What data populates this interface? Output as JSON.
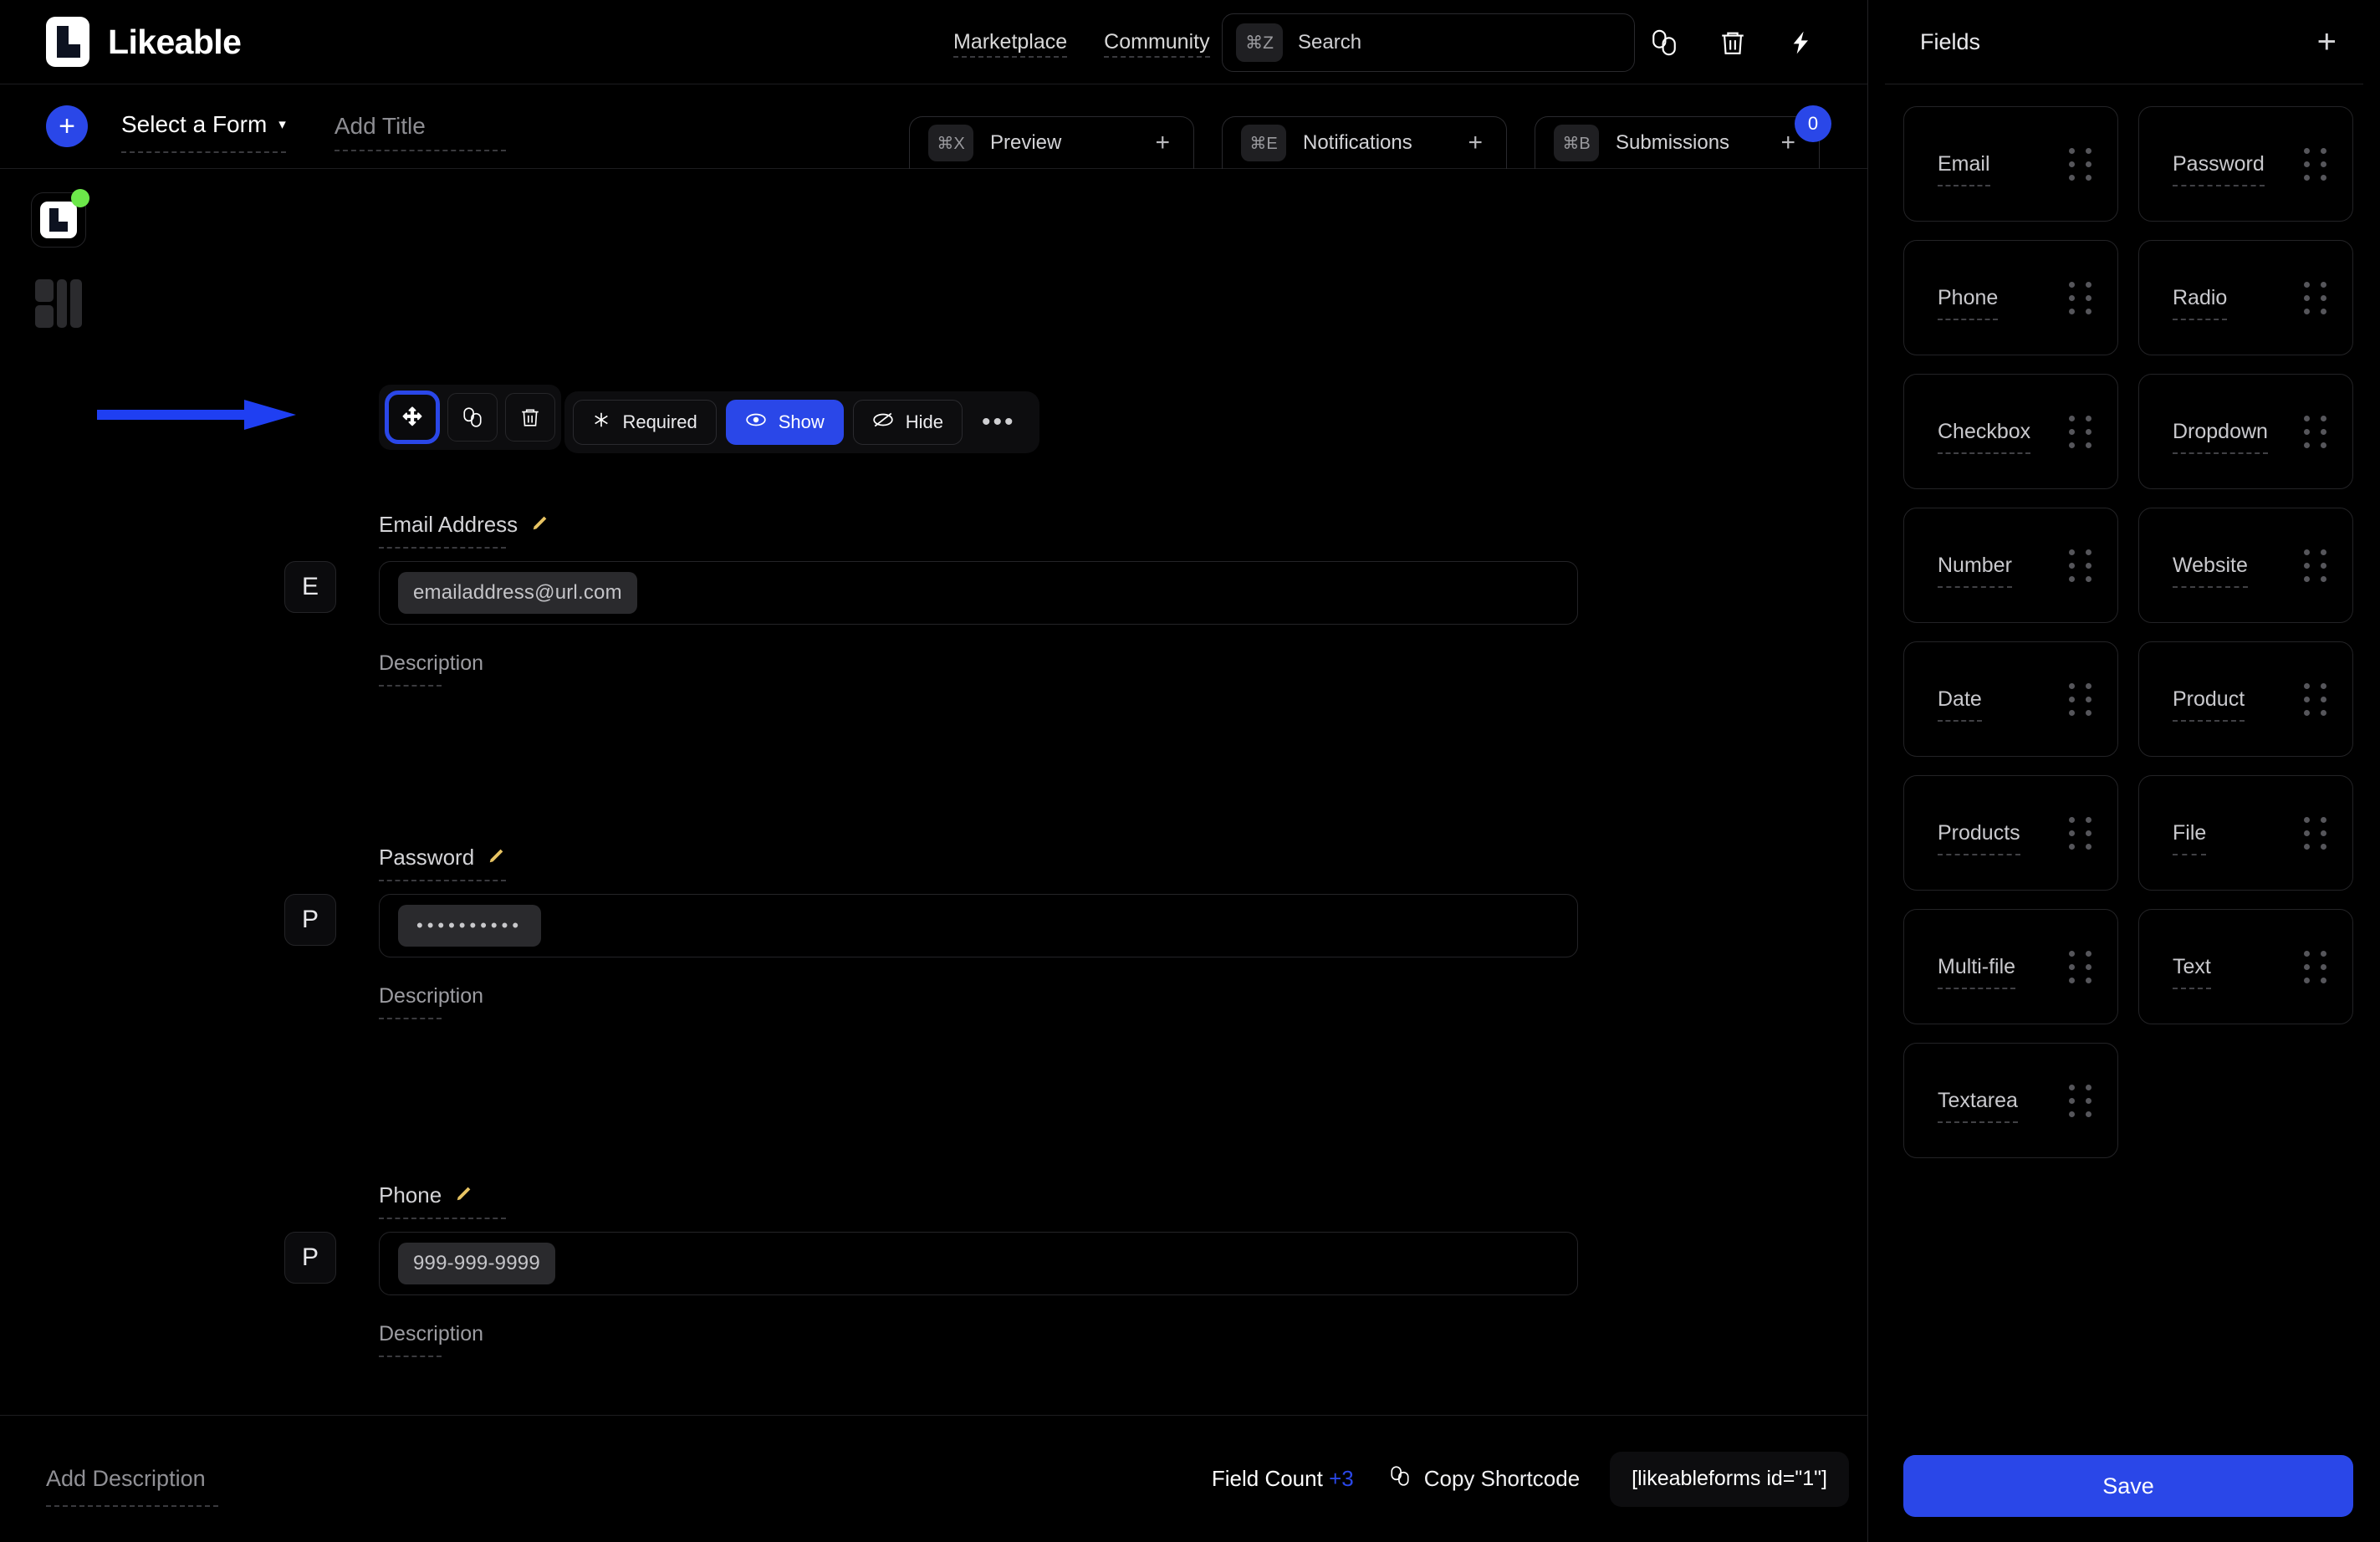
{
  "brand": {
    "name": "Likeable",
    "logo_icon": "likeable-logo-icon"
  },
  "header": {
    "nav": [
      {
        "label": "Marketplace"
      },
      {
        "label": "Community"
      }
    ],
    "search": {
      "shortcut": "⌘Z",
      "placeholder": "Search"
    },
    "icons": [
      {
        "name": "copy-icon",
        "glyph": "copy"
      },
      {
        "name": "trash-icon",
        "glyph": "trash"
      },
      {
        "name": "lightning-icon",
        "glyph": "bolt"
      }
    ]
  },
  "subheader": {
    "add_button": "+",
    "form_select": {
      "label": "Select a Form",
      "caret": "▾"
    },
    "title_placeholder": "Add Title",
    "tabs": [
      {
        "shortcut": "⌘X",
        "label": "Preview",
        "plus": "+"
      },
      {
        "shortcut": "⌘E",
        "label": "Notifications",
        "plus": "+"
      },
      {
        "shortcut": "⌘B",
        "label": "Submissions",
        "plus": "+",
        "badge": "0"
      }
    ]
  },
  "rail": {
    "logo": {
      "name": "likeable-rail-logo",
      "status": "online"
    },
    "layout": {
      "name": "layout-grid-icon"
    }
  },
  "field_toolbar": {
    "buttons": [
      {
        "name": "move-handle-icon",
        "active": true
      },
      {
        "name": "duplicate-icon",
        "active": false
      },
      {
        "name": "delete-icon",
        "active": false
      }
    ],
    "options": [
      {
        "label": "Required",
        "icon": "asterisk-icon",
        "selected": false
      },
      {
        "label": "Show",
        "icon": "eye-icon",
        "selected": true
      },
      {
        "label": "Hide",
        "icon": "eye-off-icon",
        "selected": false
      }
    ],
    "more": "•••"
  },
  "form_fields": [
    {
      "badge": "E",
      "label": "Email Address",
      "edit_icon": "pencil-icon",
      "value": "emailaddress@url.com",
      "value_style": "text",
      "description_label": "Description"
    },
    {
      "badge": "P",
      "label": "Password",
      "edit_icon": "pencil-icon",
      "value": "••••••••••",
      "value_style": "dots",
      "description_label": "Description"
    },
    {
      "badge": "P",
      "label": "Phone",
      "edit_icon": "pencil-icon",
      "value": "999-999-9999",
      "value_style": "text",
      "description_label": "Description"
    }
  ],
  "footer": {
    "add_description_placeholder": "Add Description",
    "field_count_label": "Field Count",
    "field_count_value": "+3",
    "copy_shortcode_label": "Copy Shortcode",
    "copy_shortcode_icon": "copy-icon",
    "shortcode": "[likeableforms id=\"1\"]"
  },
  "fields_panel": {
    "title": "Fields",
    "add_icon": "plus-icon",
    "items": [
      {
        "label": "Email"
      },
      {
        "label": "Password"
      },
      {
        "label": "Phone"
      },
      {
        "label": "Radio"
      },
      {
        "label": "Checkbox"
      },
      {
        "label": "Dropdown"
      },
      {
        "label": "Number"
      },
      {
        "label": "Website"
      },
      {
        "label": "Date"
      },
      {
        "label": "Product"
      },
      {
        "label": "Products"
      },
      {
        "label": "File"
      },
      {
        "label": "Multi-file"
      },
      {
        "label": "Text"
      },
      {
        "label": "Textarea"
      }
    ],
    "save_label": "Save"
  },
  "annotation": {
    "arrow_color": "#1f3ff2",
    "points_to": "move-handle-icon"
  },
  "colors": {
    "accent": "#2a47e8",
    "status_dot": "#6ce84a",
    "pencil": "#e8c463"
  }
}
